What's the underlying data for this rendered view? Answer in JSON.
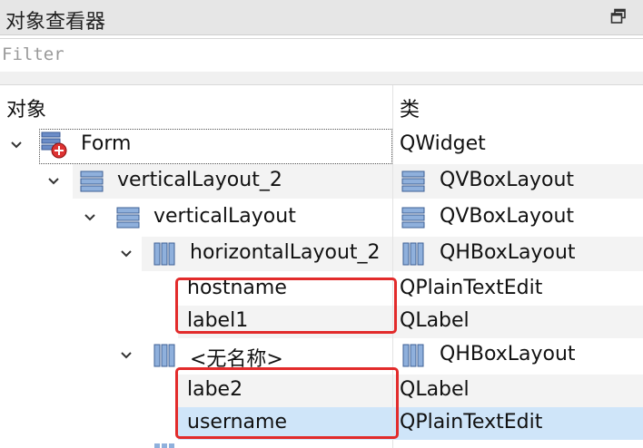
{
  "panel": {
    "title": "对象查看器",
    "float_icon": "float-window-icon"
  },
  "filter": {
    "placeholder": "Filter",
    "value": ""
  },
  "columns": {
    "object": "对象",
    "class": "类"
  },
  "tree": [
    {
      "id": "form",
      "name": "Form",
      "class": "QWidget",
      "icon": "form-widget-icon",
      "class_icon": "",
      "expanded": true,
      "row_state": "focused"
    },
    {
      "id": "verticallayout-2",
      "name": "verticalLayout_2",
      "class": "QVBoxLayout",
      "icon": "vbox-layout-icon",
      "class_icon": "vbox-layout-icon",
      "expanded": true,
      "row_state": "alt"
    },
    {
      "id": "verticallayout",
      "name": "verticalLayout",
      "class": "QVBoxLayout",
      "icon": "vbox-layout-icon",
      "class_icon": "vbox-layout-icon",
      "expanded": true,
      "row_state": "normal"
    },
    {
      "id": "horizontallayout-2",
      "name": "horizontalLayout_2",
      "class": "QHBoxLayout",
      "icon": "hbox-layout-icon",
      "class_icon": "hbox-layout-icon",
      "expanded": true,
      "row_state": "alt"
    },
    {
      "id": "hostname",
      "name": "hostname",
      "class": "QPlainTextEdit",
      "icon": "",
      "class_icon": "",
      "row_state": "normal"
    },
    {
      "id": "label1",
      "name": "label1",
      "class": "QLabel",
      "icon": "",
      "class_icon": "",
      "row_state": "alt"
    },
    {
      "id": "unnamed",
      "name": "<无名称>",
      "class": "QHBoxLayout",
      "icon": "hbox-layout-icon",
      "class_icon": "hbox-layout-icon",
      "expanded": true,
      "row_state": "normal"
    },
    {
      "id": "labe2",
      "name": "labe2",
      "class": "QLabel",
      "icon": "",
      "class_icon": "",
      "row_state": "alt"
    },
    {
      "id": "username",
      "name": "username",
      "class": "QPlainTextEdit",
      "icon": "",
      "class_icon": "",
      "row_state": "selected"
    }
  ],
  "colors": {
    "selected_row": "#cfe5f9",
    "alt_row": "#f3f3f3",
    "annotation_box": "#e22b2b"
  }
}
